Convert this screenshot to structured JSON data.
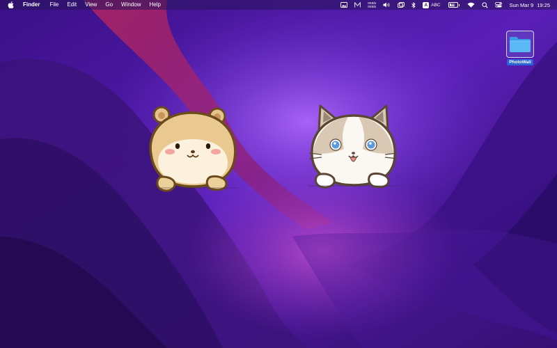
{
  "menubar": {
    "app_name": "Finder",
    "menus": [
      "File",
      "Edit",
      "View",
      "Go",
      "Window",
      "Help"
    ],
    "status": {
      "net_up": "0KB/s",
      "net_down": "0KB/s",
      "input_badge": "A",
      "input_label": "ABC",
      "battery_level": "80",
      "date": "Sun Mar 9",
      "time": "19:25"
    },
    "icons": [
      "apple-logo",
      "gallery-icon",
      "m-app-icon",
      "speaker-icon",
      "display-icon",
      "bluetooth-icon",
      "wifi-icon",
      "search-icon",
      "control-center-icon"
    ]
  },
  "desktop": {
    "icons": [
      {
        "label": "PhotoWall",
        "icon": "folder-icon",
        "selected": true
      }
    ],
    "stickers": [
      "hamster-sticker",
      "cat-sticker"
    ]
  },
  "colors": {
    "wallpaper_base": "#2a0e63",
    "selection_blue": "#2a62d8",
    "folder_blue": "#5bb8f5"
  }
}
